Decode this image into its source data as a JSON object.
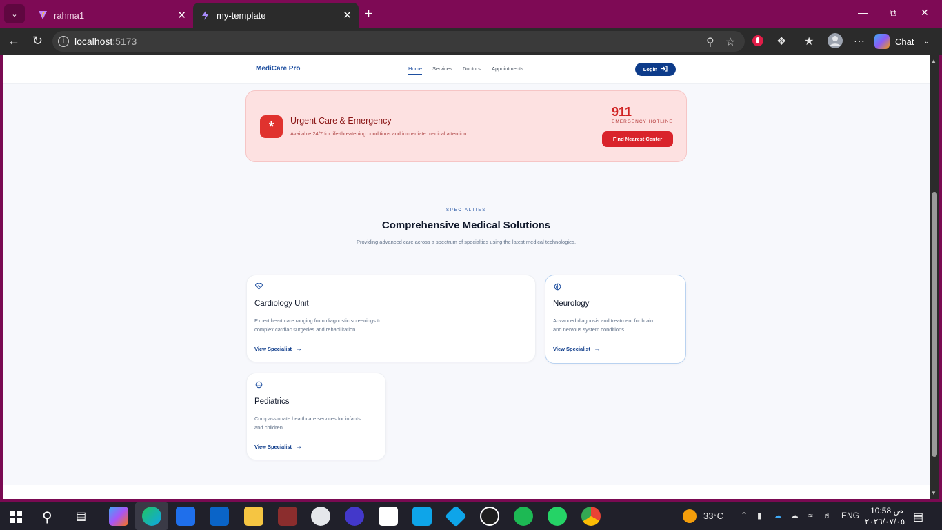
{
  "browser": {
    "tabs": [
      {
        "title": "rahma1",
        "active": false
      },
      {
        "title": "my-template",
        "active": true
      }
    ],
    "url_host": "localhost",
    "url_port": ":5173",
    "chat_label": "Chat"
  },
  "site": {
    "logo": "MediCare Pro",
    "nav": [
      "Home",
      "Services",
      "Doctors",
      "Appointments"
    ],
    "login_label": "Login"
  },
  "urgent": {
    "title": "Urgent Care & Emergency",
    "description": "Available 24/7 for life-threatening conditions and immediate medical attention.",
    "hotline_number": "911",
    "hotline_label": "EMERGENCY HOTLINE",
    "button_label": "Find Nearest Center"
  },
  "specialties": {
    "eyebrow": "SPECIALTIES",
    "headline": "Comprehensive Medical Solutions",
    "subline": "Providing advanced care across a spectrum of specialties using the latest medical technologies.",
    "cards": [
      {
        "title": "Cardiology Unit",
        "description_line1": "Expert heart care ranging from diagnostic screenings to",
        "description_line2": "complex cardiac surgeries and rehabilitation.",
        "link": "View Specialist",
        "icon": "heart-pulse-icon"
      },
      {
        "title": "Neurology",
        "description_line1": "Advanced diagnosis and treatment for brain",
        "description_line2": "and nervous system conditions.",
        "link": "View Specialist",
        "icon": "brain-icon"
      },
      {
        "title": "Pediatrics",
        "description_line1": "Compassionate healthcare services for infants",
        "description_line2": "and children.",
        "link": "View Specialist",
        "icon": "smile-icon"
      }
    ]
  },
  "taskbar": {
    "weather": "33°C",
    "language": "ENG",
    "time": "10:58 ص",
    "date": "٢٠٢٦/٠٧/٠٥"
  },
  "colors": {
    "browser_frame": "#7e0a55",
    "brand_blue": "#0d3b8a",
    "emergency_red": "#d9232b",
    "emergency_bg": "#fde1e1"
  }
}
